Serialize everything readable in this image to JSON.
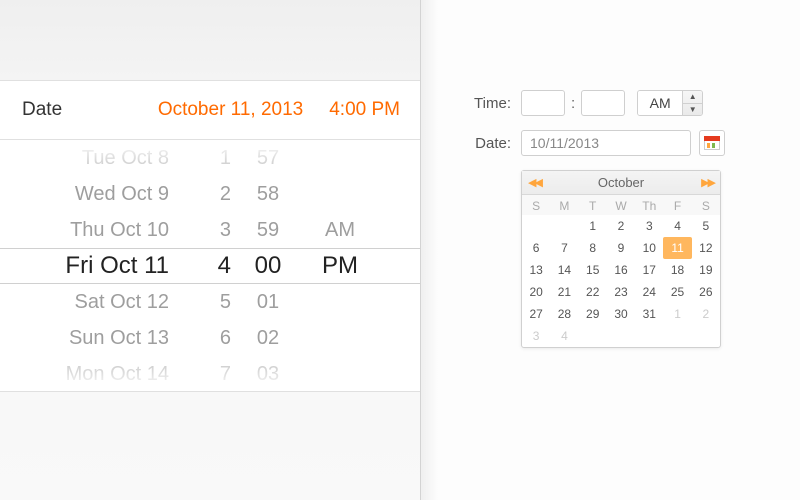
{
  "left": {
    "title": "Date",
    "date_value": "October 11, 2013",
    "time_value": "4:00 PM"
  },
  "picker": {
    "days": [
      "Tue Oct 8",
      "Wed Oct 9",
      "Thu Oct 10",
      "Fri Oct 11",
      "Sat Oct 12",
      "Sun Oct 13",
      "Mon Oct 14"
    ],
    "hours": [
      "1",
      "2",
      "3",
      "4",
      "5",
      "6",
      "7"
    ],
    "minutes": [
      "57",
      "58",
      "59",
      "00",
      "01",
      "02",
      "03"
    ],
    "ampm": [
      "",
      "",
      "AM",
      "PM",
      "",
      "",
      ""
    ]
  },
  "right": {
    "time_label": "Time:",
    "hour_value": "",
    "minute_value": "",
    "ampm_value": "AM",
    "date_label": "Date:",
    "date_value": "10/11/2013"
  },
  "calendar": {
    "month_label": "October",
    "dow": [
      "S",
      "M",
      "T",
      "W",
      "Th",
      "F",
      "S"
    ],
    "leading_other": [],
    "days": [
      1,
      2,
      3,
      4,
      5,
      6,
      7,
      8,
      9,
      10,
      11,
      12,
      13,
      14,
      15,
      16,
      17,
      18,
      19,
      20,
      21,
      22,
      23,
      24,
      25,
      26,
      27,
      28,
      29,
      30,
      31
    ],
    "trailing_other": [
      1,
      2,
      3,
      4
    ],
    "selected": 11
  },
  "colors": {
    "accent": "#ff6a00",
    "cal_accent": "#ffa63d"
  }
}
